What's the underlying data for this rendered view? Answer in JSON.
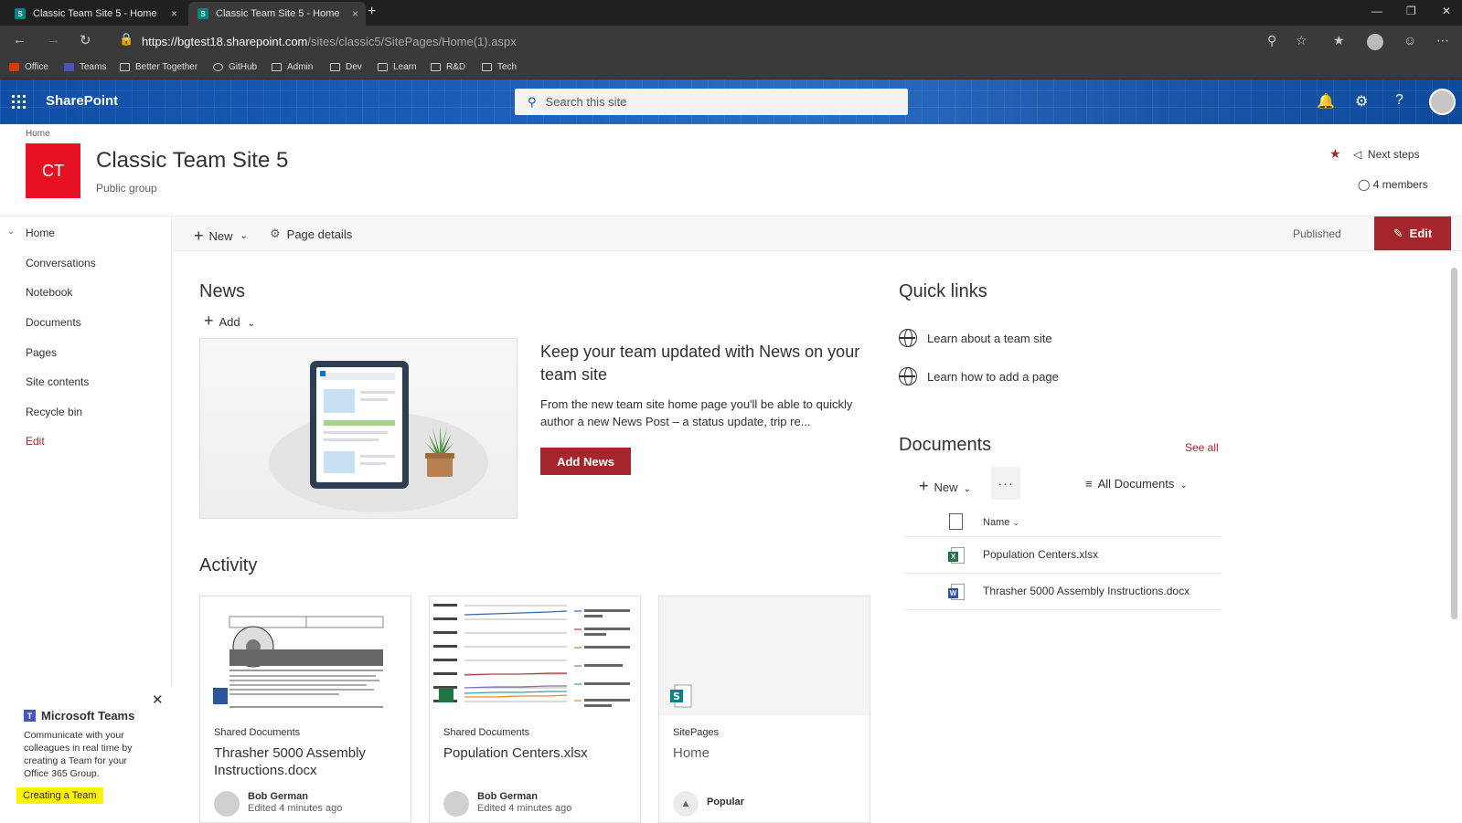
{
  "browser": {
    "tabs": [
      {
        "title": "Classic Team Site 5 - Home",
        "close": "×"
      },
      {
        "title": "Classic Team Site 5 - Home",
        "close": "×"
      }
    ],
    "new_tab": "+",
    "url_host": "https://bgtest18.sharepoint.com",
    "url_path": "/sites/classic5/SitePages/Home(1).aspx",
    "favorites": [
      "Office",
      "Teams",
      "Better Together",
      "GitHub",
      "Admin",
      "Dev",
      "Learn",
      "R&D",
      "Tech"
    ]
  },
  "suite": {
    "brand": "SharePoint",
    "search_placeholder": "Search this site"
  },
  "site": {
    "breadcrumb": "Home",
    "logo_initials": "CT",
    "title": "Classic Team Site 5",
    "subtitle": "Public group",
    "next_steps": "Next steps",
    "members": "4 members",
    "logo_color": "#e81123"
  },
  "leftnav": {
    "items": [
      "Home",
      "Conversations",
      "Notebook",
      "Documents",
      "Pages",
      "Site contents",
      "Recycle bin"
    ],
    "edit": "Edit"
  },
  "cmdbar": {
    "new": "New",
    "page_details": "Page details",
    "status": "Published",
    "edit": "Edit"
  },
  "news": {
    "title": "News",
    "add": "Add",
    "headline": "Keep your team updated with News on your team site",
    "body": "From the new team site home page you'll be able to quickly author a new News Post – a status update, trip re...",
    "button": "Add News"
  },
  "quicklinks": {
    "title": "Quick links",
    "items": [
      "Learn about a team site",
      "Learn how to add a page"
    ]
  },
  "documents": {
    "title": "Documents",
    "see_all": "See all",
    "new": "New",
    "more": "···",
    "view": "All Documents",
    "column_name": "Name",
    "files": [
      {
        "name": "Population Centers.xlsx",
        "type": "X"
      },
      {
        "name": "Thrasher 5000 Assembly Instructions.docx",
        "type": "W"
      }
    ]
  },
  "activity": {
    "title": "Activity",
    "cards": [
      {
        "library": "Shared Documents",
        "title": "Thrasher 5000 Assembly Instructions.docx",
        "author": "Bob German",
        "edited": "Edited 4 minutes ago"
      },
      {
        "library": "Shared Documents",
        "title": "Population Centers.xlsx",
        "author": "Bob German",
        "edited": "Edited 4 minutes ago"
      },
      {
        "library": "SitePages",
        "title": "Home",
        "author": "Popular",
        "edited": ""
      }
    ]
  },
  "teams_bubble": {
    "title": "Microsoft Teams",
    "body": "Communicate with your colleagues in real time by creating a Team for your Office 365 Group.",
    "link": "Creating a Team"
  },
  "colors": {
    "accent": "#a4262c",
    "suite_blue": "#1c5fba"
  }
}
